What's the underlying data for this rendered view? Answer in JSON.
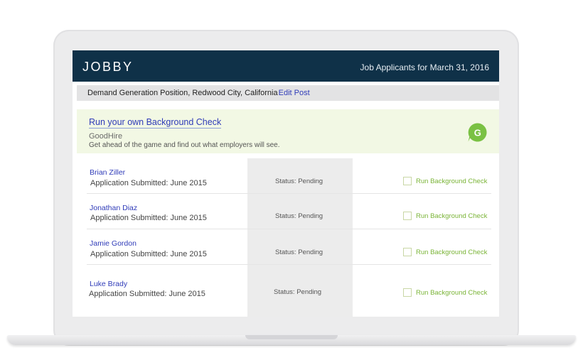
{
  "header": {
    "logo": "JOBBY",
    "title": "Job Applicants for March 31, 2016"
  },
  "job": {
    "title": "Demand Generation Position, Redwood City, California",
    "edit_label": "Edit Post"
  },
  "banner": {
    "link_text": "Run your own Background Check",
    "brand": "GoodHire",
    "description": "Get ahead of the game and find out what employers will see.",
    "logo_letter": "G",
    "logo_color": "#7ac143"
  },
  "applicants": [
    {
      "name": "Brian Ziller",
      "submitted": "Application Submitted: June 2015",
      "status": "Status: Pending",
      "action": "Run Background Check"
    },
    {
      "name": "Jonathan Diaz",
      "submitted": "Application Submitted: June 2015",
      "status": "Status: Pending",
      "action": "Run Background Check"
    },
    {
      "name": "Jamie Gordon",
      "submitted": "Application Submitted: June 2015",
      "status": "Status: Pending",
      "action": "Run Background Check"
    },
    {
      "name": "Luke Brady",
      "submitted": "Application Submitted: June 2015",
      "status": "Status: Pending",
      "action": "Run Background Check"
    }
  ],
  "colors": {
    "header_bg": "#0f3148",
    "link": "#2f3bb8",
    "action": "#7ab437"
  }
}
